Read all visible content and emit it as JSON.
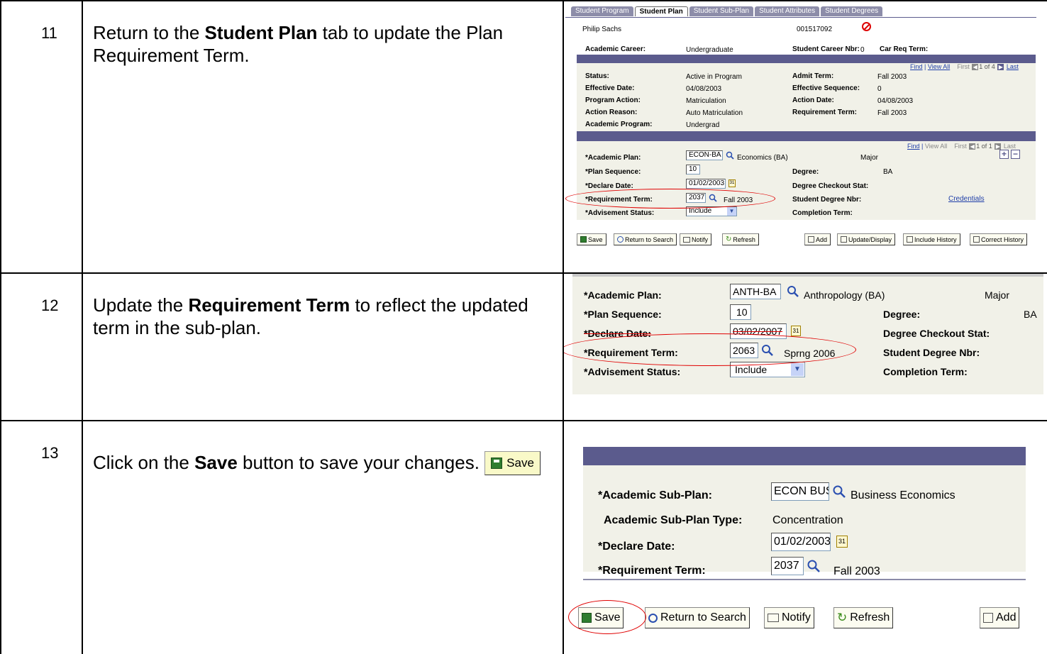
{
  "rows": [
    {
      "step": "11",
      "text_before": "Return to the ",
      "text_bold": "Student Plan",
      "text_after": " tab to update the Plan Requirement Term."
    },
    {
      "step": "12",
      "text_before": "Update the ",
      "text_bold": "Requirement Term",
      "text_after": " to reflect the updated term in the sub-plan."
    },
    {
      "step": "13",
      "text_before": "Click on the ",
      "text_bold": "Save",
      "text_after": " button to save your changes.",
      "save_button_label": "Save"
    }
  ],
  "shot1": {
    "tabs": [
      "Student Program",
      "Student Plan",
      "Student Sub-Plan",
      "Student Attributes",
      "Student Degrees"
    ],
    "active_tab": "Student Plan",
    "student_name": "Philip Sachs",
    "student_id": "001517092",
    "academic_career_label": "Academic Career:",
    "academic_career": "Undergraduate",
    "career_nbr_label": "Student Career Nbr:",
    "career_nbr": "0",
    "car_req_term_label": "Car Req Term:",
    "nav1": {
      "find": "Find",
      "view_all": "View All",
      "first": "First",
      "count": "1 of 4",
      "last": "Last"
    },
    "status_label": "Status:",
    "status": "Active in Program",
    "admit_term_label": "Admit Term:",
    "admit_term": "Fall 2003",
    "effective_date_label": "Effective Date:",
    "effective_date": "04/08/2003",
    "effective_seq_label": "Effective Sequence:",
    "effective_seq": "0",
    "program_action_label": "Program Action:",
    "program_action": "Matriculation",
    "action_date_label": "Action Date:",
    "action_date": "04/08/2003",
    "action_reason_label": "Action Reason:",
    "action_reason": "Auto Matriculation",
    "requirement_term_label": "Requirement Term:",
    "requirement_term": "Fall 2003",
    "academic_program_label": "Academic Program:",
    "academic_program": "Undergrad",
    "nav2": {
      "find": "Find",
      "view_all": "View All",
      "first": "First",
      "count": "1 of 1",
      "last": "Last"
    },
    "plan_label": "*Academic Plan:",
    "plan_value": "ECON-BA",
    "plan_desc": "Economics (BA)",
    "plan_type": "Major",
    "plan_seq_label": "*Plan Sequence:",
    "plan_seq": "10",
    "degree_label": "Degree:",
    "degree": "BA",
    "declare_label": "*Declare Date:",
    "declare_value": "01/02/2003",
    "checkout_label": "Degree Checkout Stat:",
    "req_term_label": "*Requirement Term:",
    "req_term_value": "2037",
    "req_term_desc": "Fall 2003",
    "degree_nbr_label": "Student Degree Nbr:",
    "credentials_link": "Credentials",
    "advisement_label": "*Advisement Status:",
    "advisement_value": "Include",
    "completion_label": "Completion Term:",
    "buttons": [
      "Save",
      "Return to Search",
      "Notify",
      "Refresh",
      "Add",
      "Update/Display",
      "Include History",
      "Correct History"
    ]
  },
  "shot2": {
    "plan_label": "*Academic Plan:",
    "plan_value": "ANTH-BA",
    "plan_desc": "Anthropology (BA)",
    "plan_type": "Major",
    "plan_seq_label": "*Plan Sequence:",
    "plan_seq": "10",
    "degree_label": "Degree:",
    "degree": "BA",
    "declare_label": "*Declare Date:",
    "declare_value": "03/02/2007",
    "checkout_label": "Degree Checkout Stat:",
    "req_term_label": "*Requirement Term:",
    "req_term_value": "2063",
    "req_term_desc": "Sprng 2006",
    "degree_nbr_label": "Student Degree Nbr:",
    "advisement_label": "*Advisement Status:",
    "advisement_value": "Include",
    "completion_label": "Completion Term:"
  },
  "shot3": {
    "subplan_label": "*Academic Sub-Plan:",
    "subplan_value": "ECON BUSEC",
    "subplan_desc": "Business Economics",
    "subplan_type_label": "Academic Sub-Plan Type:",
    "subplan_type": "Concentration",
    "declare_label": "*Declare Date:",
    "declare_value": "01/02/2003",
    "req_term_label": "*Requirement Term:",
    "req_term_value": "2037",
    "req_term_desc": "Fall 2003",
    "buttons": [
      "Save",
      "Return to Search",
      "Notify",
      "Refresh",
      "Add"
    ]
  },
  "colors": {
    "band": "#5b5b8d",
    "panel": "#f1f1e8",
    "highlight_oval": "#e00000",
    "link": "#1f3ea8"
  }
}
